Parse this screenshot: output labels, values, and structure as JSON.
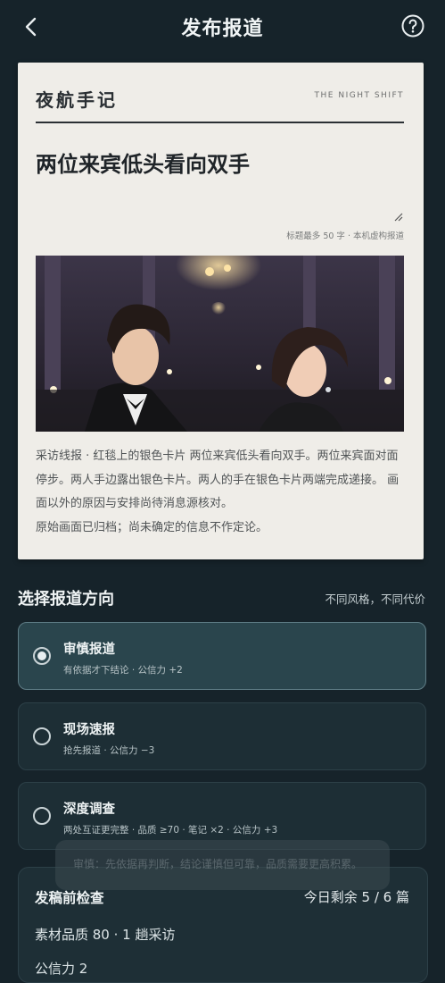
{
  "header": {
    "title": "发布报道"
  },
  "card": {
    "masthead": "夜航手记",
    "masthead_en": "THE NIGHT SHIFT",
    "headline": "两位来宾低头看向双手",
    "hint": "标题最多 50 字 · 本机虚构报道",
    "body": [
      "采访线报 · 红毯上的银色卡片 两位来宾低头看向双手。两位来宾面对面停步。两人手边露出银色卡片。两人的手在银色卡片两端完成递接。 画面以外的原因与安排尚待消息源核对。",
      "原始画面已归档；尚未确定的信息不作定论。"
    ]
  },
  "section": {
    "title": "选择报道方向",
    "note": "不同风格，不同代价"
  },
  "options": [
    {
      "label": "审慎报道",
      "sub": "有依据才下结论 · 公信力 +2",
      "selected": true
    },
    {
      "label": "现场速报",
      "sub": "抢先报道 · 公信力 −3",
      "selected": false
    },
    {
      "label": "深度调查",
      "sub": "两处互证更完整 · 品质 ≥70 · 笔记 ×2 · 公信力 +3",
      "selected": false
    }
  ],
  "toast": {
    "text": "审慎：先依据再判断，结论谨慎但可靠，品质需要更高积累。"
  },
  "precheck": {
    "title": "发稿前检查",
    "remaining": "今日剩余 5 / 6 篇",
    "material": "素材品质 80 · 1 趟采访",
    "credibility": "公信力 2"
  },
  "colors": {
    "background": "#16232a",
    "paper": "#efede8",
    "selected_option": "#2a454d"
  }
}
